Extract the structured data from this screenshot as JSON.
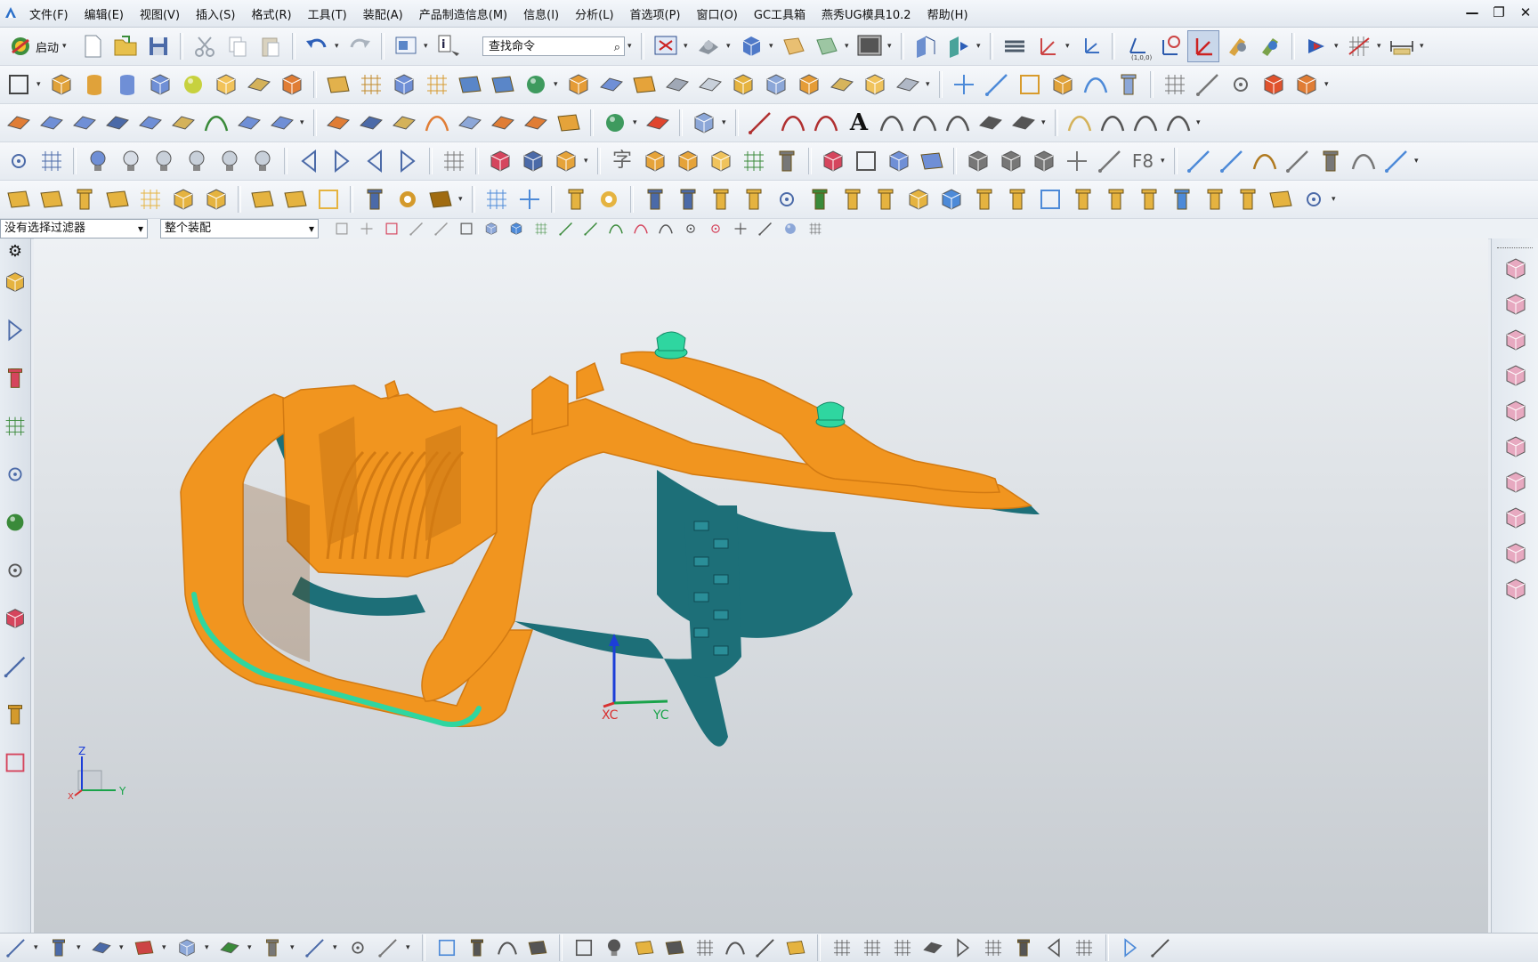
{
  "menu": {
    "items": [
      "文件(F)",
      "编辑(E)",
      "视图(V)",
      "插入(S)",
      "格式(R)",
      "工具(T)",
      "装配(A)",
      "产品制造信息(M)",
      "信息(I)",
      "分析(L)",
      "首选项(P)",
      "窗口(O)",
      "GC工具箱",
      "燕秀UG模具10.2",
      "帮助(H)"
    ]
  },
  "window_controls": {
    "minimize": "—",
    "restore": "❐",
    "close": "✕"
  },
  "toolbar": {
    "start_label": "启动",
    "search_placeholder": "查找命令",
    "filter_value": "没有选择过滤器",
    "scope_value": "整个装配",
    "f8_label": "F8",
    "text_tool_label": "A",
    "char_tool_label": "字"
  },
  "viewport": {
    "wcs_x_label": "XC",
    "wcs_y_label": "YC",
    "triad_z_label": "Z",
    "triad_y_label": "Y",
    "triad_x_label": "X"
  },
  "colors": {
    "part_orange": "#f1951f",
    "part_orange_dark": "#d27a12",
    "cavity_teal": "#1d6f78",
    "highlight_green": "#2fd6a0",
    "wcs_blue": "#1c3ed8",
    "wcs_green": "#1aa34a",
    "wcs_red": "#d83030"
  }
}
